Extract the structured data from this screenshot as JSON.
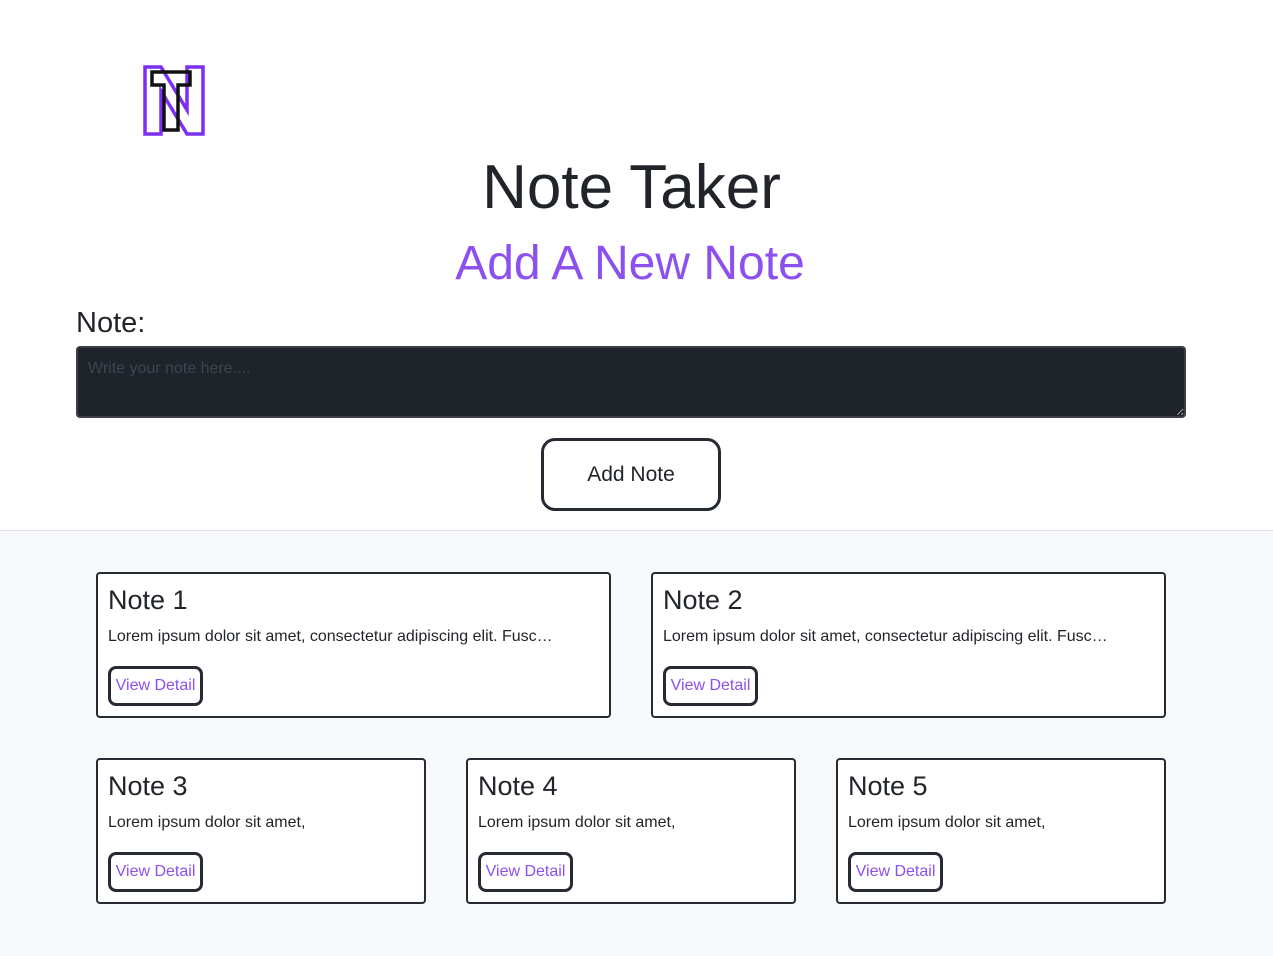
{
  "header": {
    "title": "Note Taker",
    "subtitle": "Add A New Note",
    "logo_icon": "nt-logo-icon"
  },
  "form": {
    "label": "Note:",
    "placeholder": "Write your note here....",
    "value": "",
    "submit_label": "Add Note"
  },
  "colors": {
    "accent": "#8c4ff0",
    "dark": "#212529",
    "input_bg": "#1f242b"
  },
  "notes": [
    {
      "title": "Note 1",
      "text": "Lorem ipsum dolor sit amet, consectetur adipiscing elit. Fusce vel sapien vitae nisi malesuada vulputate.",
      "button": "View Detail"
    },
    {
      "title": "Note 2",
      "text": "Lorem ipsum dolor sit amet, consectetur adipiscing elit. Fusce vel sapien vitae nisi malesuada vulputate.",
      "button": "View Detail"
    },
    {
      "title": "Note 3",
      "text": "Lorem ipsum dolor sit amet,",
      "button": "View Detail"
    },
    {
      "title": "Note 4",
      "text": "Lorem ipsum dolor sit amet,",
      "button": "View Detail"
    },
    {
      "title": "Note 5",
      "text": "Lorem ipsum dolor sit amet,",
      "button": "View Detail"
    }
  ]
}
